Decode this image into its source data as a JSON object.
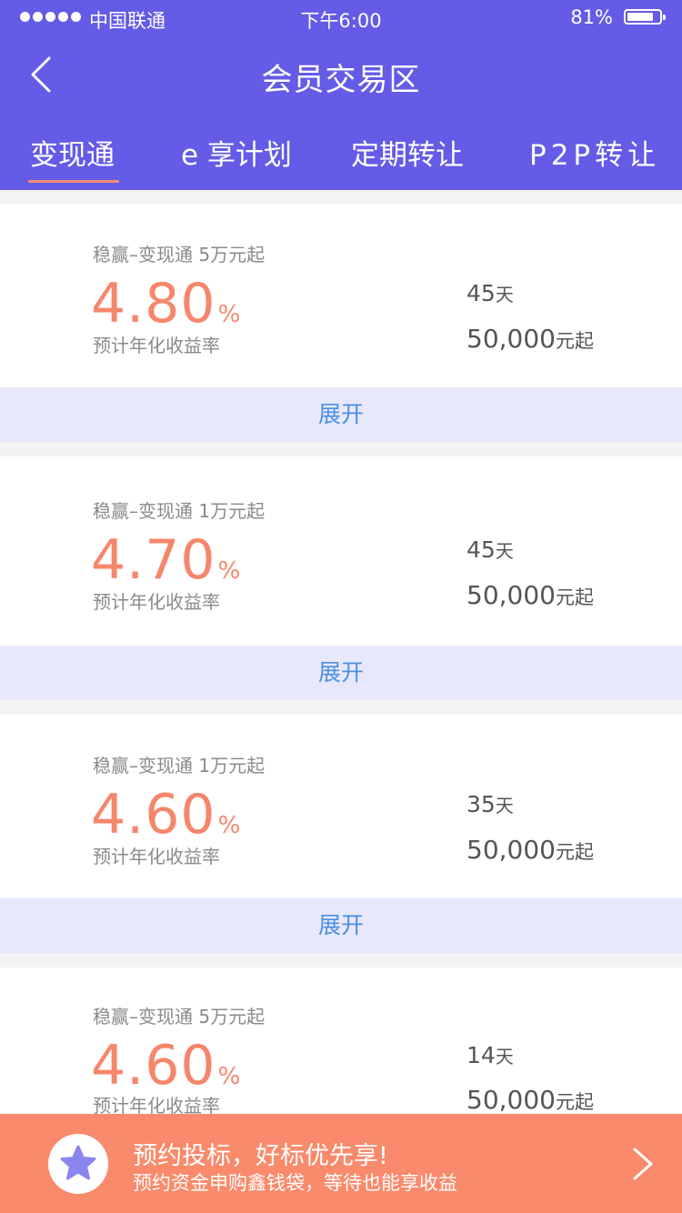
{
  "status_bar": {
    "carrier": "中国联通",
    "time": "下午6:00",
    "battery": "81%",
    "battery_level": 0.81
  },
  "header": {
    "title": "会员交易区",
    "back_icon": "chevron-left-icon"
  },
  "tabs": [
    {
      "label": "变现通",
      "active": true
    },
    {
      "label": "e 享计划",
      "active": false
    },
    {
      "label": "定期转让",
      "active": false
    },
    {
      "label": "P2P转让",
      "active": false
    }
  ],
  "colors": {
    "header_bg": "#645be6",
    "rate": "#f6866b",
    "expand_bg": "#e7e8fb",
    "expand_text": "#4a90e2",
    "banner_bg": "#f98a6b"
  },
  "products": [
    {
      "name": "稳赢–变现通 5万元起",
      "rate": "4.80",
      "rate_unit": "%",
      "rate_label": "预计年化收益率",
      "term": "45",
      "term_unit": "天",
      "amount": "50,000",
      "amount_unit": "元起",
      "expand_label": "展开"
    },
    {
      "name": "稳赢–变现通 1万元起",
      "rate": "4.70",
      "rate_unit": "%",
      "rate_label": "预计年化收益率",
      "term": "45",
      "term_unit": "天",
      "amount": "50,000",
      "amount_unit": "元起",
      "expand_label": "展开"
    },
    {
      "name": "稳赢–变现通 1万元起",
      "rate": "4.60",
      "rate_unit": "%",
      "rate_label": "预计年化收益率",
      "term": "35",
      "term_unit": "天",
      "amount": "50,000",
      "amount_unit": "元起",
      "expand_label": "展开"
    },
    {
      "name": "稳赢–变现通 5万元起",
      "rate": "4.60",
      "rate_unit": "%",
      "rate_label": "预计年化收益率",
      "term": "14",
      "term_unit": "天",
      "amount": "50,000",
      "amount_unit": "元起"
    }
  ],
  "banner": {
    "title": "预约投标，好标优先享!",
    "subtitle": "预约资金申购鑫钱袋，等待也能享收益",
    "icon": "star-icon",
    "arrow_icon": "chevron-right-icon"
  }
}
